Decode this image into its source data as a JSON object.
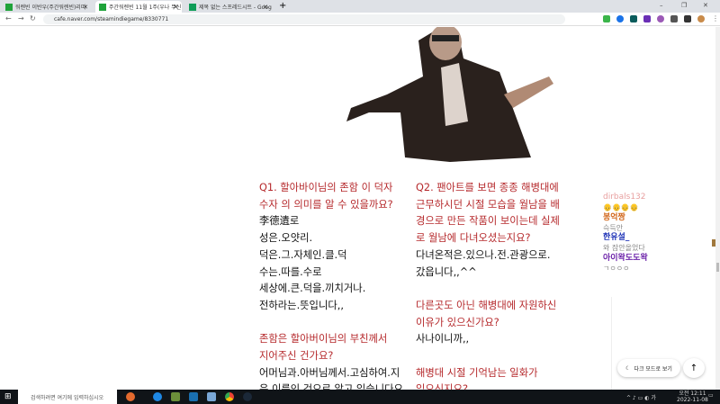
{
  "browser": {
    "tabs": [
      {
        "title": "워렌빈 이반우(주간워렌빈)리미",
        "active": false
      },
      {
        "title": "주간워렌빈 11월 1주(우나 무신",
        "active": true
      },
      {
        "title": "제목 없는 스프레드시트 - Goog",
        "active": false
      }
    ],
    "new_tab": "+",
    "url": "cafe.naver.com/steamindiegame/8330771"
  },
  "article": {
    "left_column": [
      {
        "text": "Q1. 할아바이님의 존함 이 덕자",
        "type": "q"
      },
      {
        "text": "수자 의 의미를 알 수 있을까요?",
        "type": "q"
      },
      {
        "text": "李德遺로",
        "type": "a"
      },
      {
        "text": "성은.오얏리.",
        "type": "a"
      },
      {
        "text": "덕은.그.자체인.클.덕",
        "type": "a"
      },
      {
        "text": "수는.따를.수로",
        "type": "a"
      },
      {
        "text": "세상에.큰.덕을.끼치거나.",
        "type": "a"
      },
      {
        "text": "전하라는.뜻입니다,,",
        "type": "a"
      },
      {
        "text": "",
        "type": "gap"
      },
      {
        "text": "존함은 할아버이님의 부친께서",
        "type": "q"
      },
      {
        "text": "지어주신 건가요?",
        "type": "q"
      },
      {
        "text": "어머님과.아버님께서.고심하여.지",
        "type": "a"
      },
      {
        "text": "은.이름인.것으로.알고.있습니다요",
        "type": "a"
      }
    ],
    "right_column": [
      {
        "text": "Q2. 팬아트를 보면 종종 해병대에",
        "type": "q"
      },
      {
        "text": "근무하시던 시절 모습을 월남을 배",
        "type": "q"
      },
      {
        "text": "경으로 만든 작품이 보이는데 실제",
        "type": "q"
      },
      {
        "text": "로 월남에 다녀오셨는지요?",
        "type": "q"
      },
      {
        "text": "다녀온적은.있으나.전.관광으로.",
        "type": "a"
      },
      {
        "text": "갔읍니다,,^^",
        "type": "a"
      },
      {
        "text": "",
        "type": "gap"
      },
      {
        "text": "다른곳도 아닌 해병대에 자원하신",
        "type": "q"
      },
      {
        "text": "이유가 있으신가요?",
        "type": "q"
      },
      {
        "text": "사나이니까,,",
        "type": "a"
      },
      {
        "text": "",
        "type": "gap"
      },
      {
        "text": "해병대 시절 기억남는 일화가",
        "type": "q"
      },
      {
        "text": "있으신지요?",
        "type": "q"
      }
    ]
  },
  "chat": [
    {
      "user": "dirbals132",
      "message": "👴👴👴👴",
      "color": "#e8a0a0"
    },
    {
      "user": "봉억짱",
      "message": "슥득안",
      "color": "#d2691e"
    },
    {
      "user": "한유설_",
      "message": "와 잠안올었다",
      "color": "#1a2fb5"
    },
    {
      "user": "아이왁도도왁",
      "message": "ㄱㅇㅇㅇ",
      "color": "#6a1fa8"
    }
  ],
  "buttons": {
    "dark_mode": "다크 모드로 보기",
    "top": "↑"
  },
  "taskbar": {
    "search_placeholder": "검색하려면 여기에 입력하십시오",
    "time": "오전 12:11",
    "date": "2022-11-08"
  },
  "colors": {
    "question": "#b5282b",
    "answer": "#111111"
  }
}
